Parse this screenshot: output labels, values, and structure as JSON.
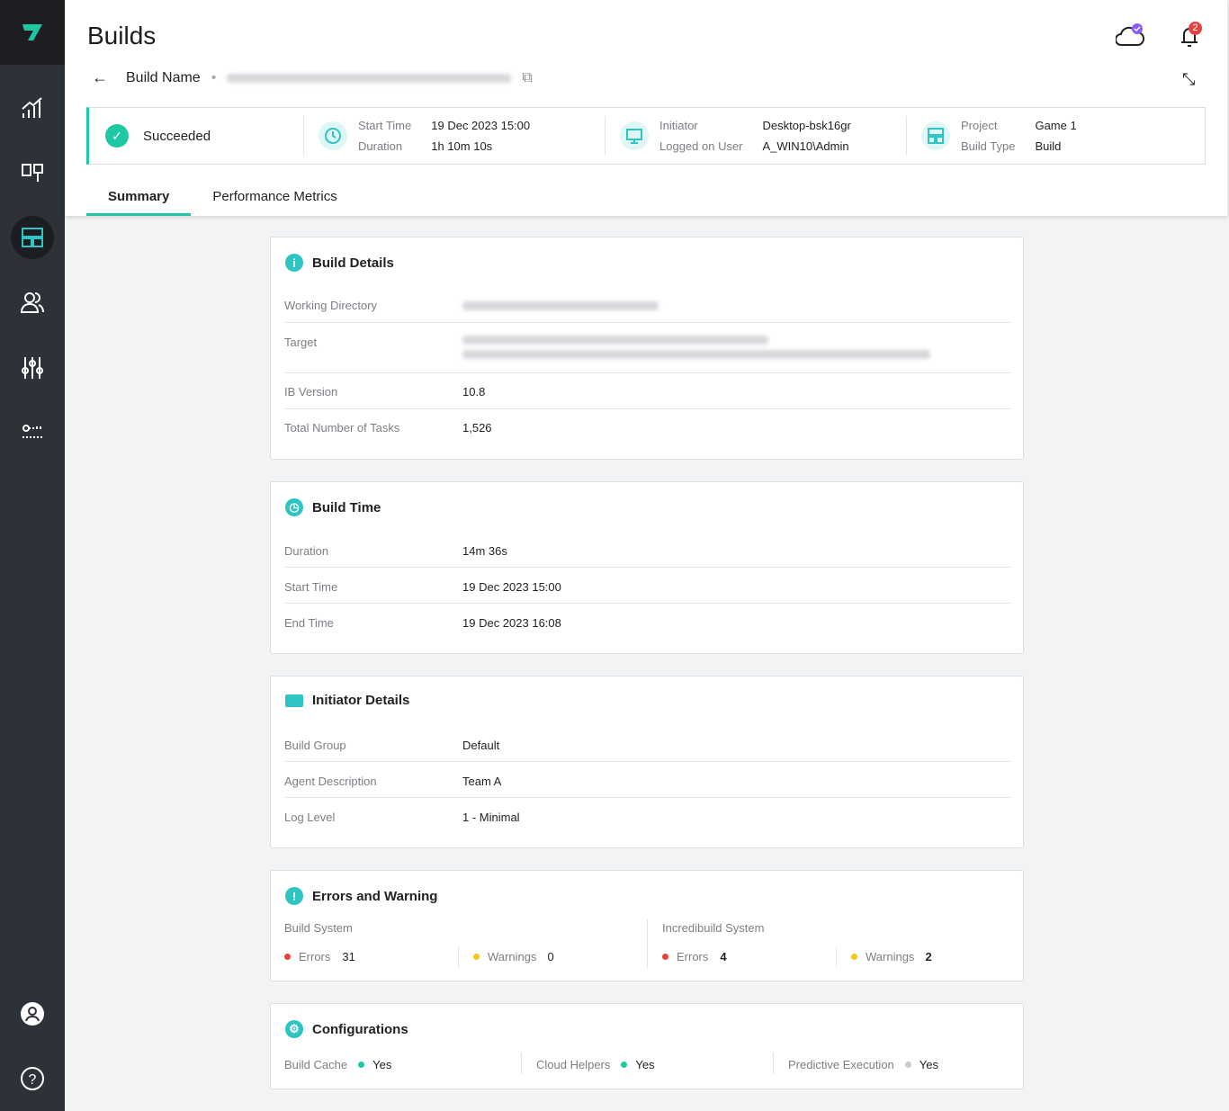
{
  "header": {
    "title": "Builds",
    "breadcrumb_label": "Build Name",
    "notification_count": "2"
  },
  "status": {
    "result": "Succeeded",
    "start_time_label": "Start Time",
    "start_time": "19 Dec 2023 15:00",
    "duration_label": "Duration",
    "duration": "1h 10m 10s",
    "initiator_label": "Initiator",
    "initiator": "Desktop-bsk16gr",
    "user_label": "Logged on User",
    "user": "A_WIN10\\Admin",
    "project_label": "Project",
    "project": "Game 1",
    "build_type_label": "Build Type",
    "build_type": "Build"
  },
  "tabs": [
    {
      "label": "Summary",
      "active": true
    },
    {
      "label": "Performance Metrics",
      "active": false
    }
  ],
  "build_details": {
    "title": "Build Details",
    "rows": [
      {
        "label": "Working Directory"
      },
      {
        "label": "Target"
      },
      {
        "label": "IB Version",
        "value": "10.8"
      },
      {
        "label": "Total Number of Tasks",
        "value": "1,526"
      }
    ]
  },
  "build_time": {
    "title": "Build Time",
    "rows": [
      {
        "label": "Duration",
        "value": "14m 36s"
      },
      {
        "label": "Start Time",
        "value": "19 Dec 2023 15:00"
      },
      {
        "label": "End Time",
        "value": "19 Dec 2023 16:08"
      }
    ]
  },
  "initiator_details": {
    "title": "Initiator Details",
    "rows": [
      {
        "label": "Build Group",
        "value": "Default"
      },
      {
        "label": "Agent Description",
        "value": "Team A"
      },
      {
        "label": "Log Level",
        "value": "1 - Minimal"
      }
    ]
  },
  "errors": {
    "title": "Errors and Warning",
    "build_system": {
      "label": "Build System",
      "errors_label": "Errors",
      "errors": "31",
      "warnings_label": "Warnings",
      "warnings": "0"
    },
    "incredibuild_system": {
      "label": "Incredibuild System",
      "errors_label": "Errors",
      "errors": "4",
      "warnings_label": "Warnings",
      "warnings": "2"
    }
  },
  "configurations": {
    "title": "Configurations",
    "items": [
      {
        "label": "Build Cache",
        "value": "Yes",
        "color": "#1fc8a4"
      },
      {
        "label": "Cloud Helpers",
        "value": "Yes",
        "color": "#1fc8a4"
      },
      {
        "label": "Predictive Execution",
        "value": "Yes",
        "color": "#c8cacc"
      }
    ]
  },
  "colors": {
    "accent": "#1fc8a4",
    "error": "#e8413e",
    "warning": "#f5c518",
    "sidebar": "#2d3138"
  }
}
